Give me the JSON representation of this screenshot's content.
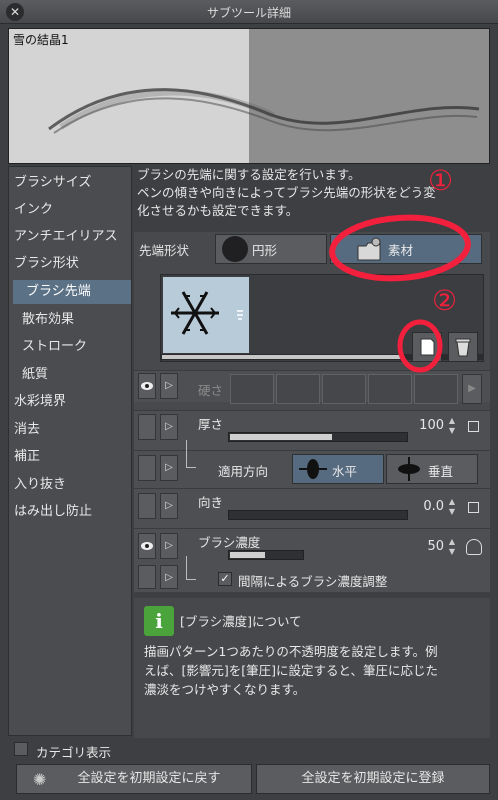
{
  "window": {
    "title": "サブツール詳細"
  },
  "preview": {
    "name": "雪の結晶1"
  },
  "categories": [
    "ブラシサイズ",
    "インク",
    "アンチエイリアス",
    "ブラシ形状",
    "ブラシ先端",
    "散布効果",
    "ストローク",
    "紙質",
    "水彩境界",
    "消去",
    "補正",
    "入り抜き",
    "はみ出し防止"
  ],
  "description": {
    "line1": "ブラシの先端に関する設定を行います。",
    "line2": "ペンの傾きや向きによってブラシ先端の形状をどう変",
    "line3": "化させるかも設定できます。"
  },
  "tip_shape": {
    "label": "先端形状",
    "circle": "円形",
    "material": "素材",
    "selected": "素材"
  },
  "hardness": {
    "label": "硬さ"
  },
  "thickness": {
    "label": "厚さ",
    "value": "100",
    "fill_percent": 100
  },
  "direction_apply": {
    "label": "適用方向",
    "horizontal": "水平",
    "vertical": "垂直",
    "selected": "水平"
  },
  "orientation": {
    "label": "向き",
    "value": "0.0",
    "fill_percent": 0
  },
  "density": {
    "label": "ブラシ濃度",
    "value": "50",
    "fill_percent": 50,
    "checkbox_label": "間隔によるブラシ濃度調整",
    "checked": true
  },
  "info": {
    "title": "[ブラシ濃度]について",
    "line1": "描画パターン1つあたりの不透明度を設定します。例",
    "line2": "えば、[影響元]を[筆圧]に設定すると、筆圧に応じた",
    "line3": "濃淡をつけやすくなります。"
  },
  "category_toggle": {
    "label": "カテゴリ表示",
    "checked": false
  },
  "buttons": {
    "reset": "全設定を初期設定に戻す",
    "register": "全設定を初期設定に登録"
  },
  "annotations": {
    "one": "①",
    "two": "②"
  },
  "colors": {
    "accent_selected": "#566b80",
    "annotation_red": "#f2203c",
    "info_green": "#4aa33b"
  }
}
